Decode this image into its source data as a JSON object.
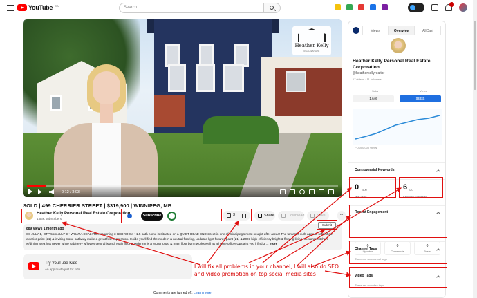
{
  "header": {
    "logo_text": "YouTube",
    "logo_region": "CA",
    "search_placeholder": "Search"
  },
  "video": {
    "time": "0:12 / 3:03",
    "progress_fraction": 0.06,
    "watermark_name": "Heather Kelly",
    "watermark_sub": "REAL ESTATE"
  },
  "title": "SOLD | 499 CHERRIER STREET | $319,900 | WINNIPEG, MB",
  "channel": {
    "name": "Heather Kelly Personal Real Estate Corporation",
    "subs": "1.56K subscribers",
    "subscribe_label": "Subscribe"
  },
  "actions": {
    "like_count": "3",
    "share": "Share",
    "download": "Download",
    "save": "Save",
    "more": "...",
    "submit": "Submit"
  },
  "description": {
    "meta": "889 views  1 month ago",
    "text": "SS JULY 1, OTP 5pm JULY 9 • WHAT A DEAL! This charming 3-BEDROOM • 1.5 bath home is situated on a QUIET DEAD END street in one of Winnipeg's most sought-after areas! The fantastic curb appeal, refinished exterior paint (21) & inviting stone pathway make a great first impression. Inside you'll find the modern & neutral flooring, updated light fixtures/paint (21) & 2023 high-efficiency bright & flowing living rm. Large kitchen w/dining area has newer white cabinetry w/lovely central island. Main floor powder rm is a MUST plus, & main floor bdrm works well as a home office! Upstairs you'll find 3 ...",
    "more": "more"
  },
  "kids": {
    "title": "Try YouTube Kids",
    "subtitle": "An app made just for kids"
  },
  "comments": {
    "text": "Comments are turned off.",
    "link": "Learn more"
  },
  "pitch": "I will fix all problems in your channel, I will also do SEO and video promotion on top social media sites",
  "panel": {
    "tabs": [
      "Views",
      "Overview",
      "AllCast"
    ],
    "name": "Heather Kelly Personal Real Estate Corporation",
    "handle": "@heatherkellyrealtor",
    "stats": "17 videos  ·  11 followers",
    "col_left": "Subs",
    "col_right": "Views",
    "box_left": "1,646",
    "box_right": "$$$$$",
    "graph_label": "~0.000.000 views",
    "sections": {
      "controversial": "Controversial Keywords",
      "tags_count": "0",
      "tags_suffix": "/500",
      "tags_label": "tags used",
      "keyword_count": "6",
      "keyword_suffix": "/20",
      "keyword_label": "Keyword suggested",
      "engagement": "Recent Engagement",
      "upvotes": "0",
      "upvotes_lbl": "Upvotes",
      "comments_n": "0",
      "comments_lbl": "Comments",
      "posts_n": "0",
      "posts_lbl": "Posts",
      "channel_tags": "Channel Tags",
      "channel_tags_ph": "There are no channel tags",
      "video_tags": "Video Tags",
      "video_tags_ph": "There are no video tags"
    }
  },
  "colors": {
    "accent_red": "#e01010",
    "yt_red": "#ff0000",
    "blue": "#1a5fd0"
  }
}
